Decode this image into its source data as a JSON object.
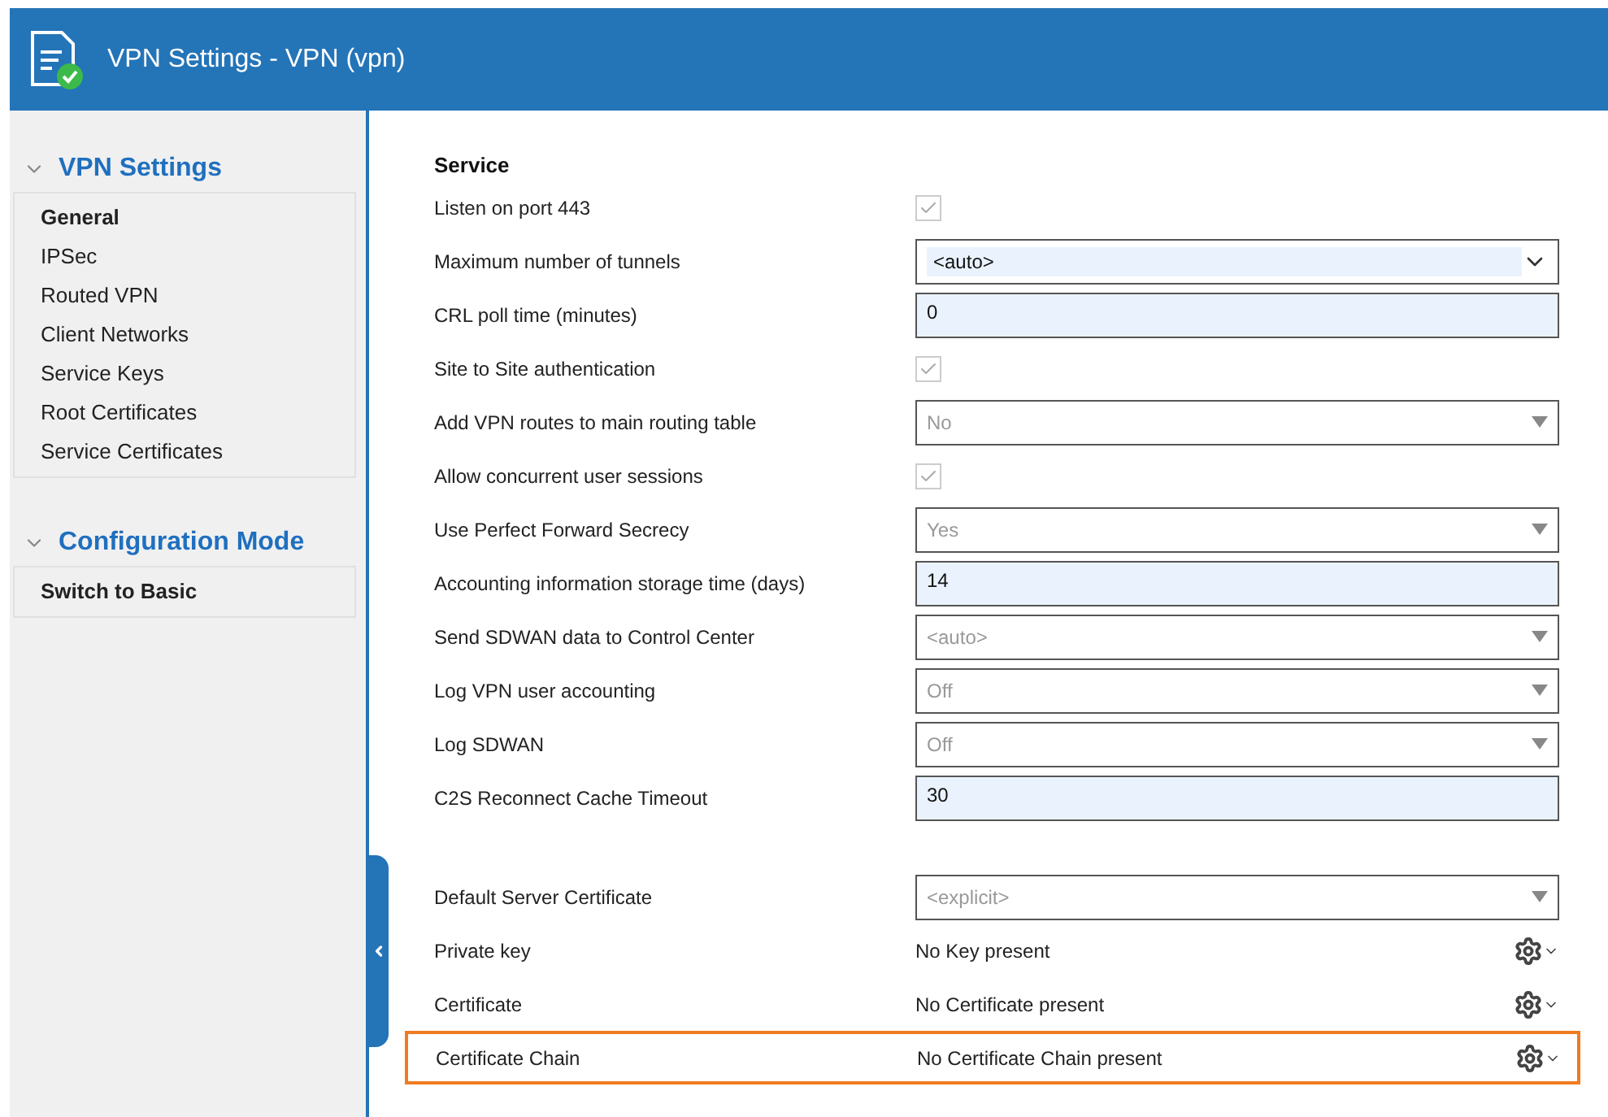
{
  "window": {
    "title": "VPN Settings - VPN (vpn)"
  },
  "sidebar": {
    "sections": [
      {
        "title": "VPN Settings",
        "expanded": true,
        "items": [
          {
            "label": "General",
            "selected": true,
            "kind": "page"
          },
          {
            "label": "IPSec",
            "selected": false,
            "kind": "page"
          },
          {
            "label": "Routed VPN",
            "selected": false,
            "kind": "page"
          },
          {
            "label": "Client Networks",
            "selected": false,
            "kind": "page"
          },
          {
            "label": "Service Keys",
            "selected": false,
            "kind": "page"
          },
          {
            "label": "Root Certificates",
            "selected": false,
            "kind": "page"
          },
          {
            "label": "Service Certificates",
            "selected": false,
            "kind": "page"
          }
        ]
      },
      {
        "title": "Configuration Mode",
        "expanded": true,
        "items": [
          {
            "label": "Switch to Basic",
            "selected": false,
            "kind": "action"
          }
        ]
      }
    ]
  },
  "service": {
    "title": "Service",
    "groups": [
      [
        {
          "label": "Listen on port 443",
          "kind": "checkbox",
          "checked": true,
          "disabled": true
        },
        {
          "label": "Maximum number of tunnels",
          "kind": "combo",
          "value": "<auto>"
        },
        {
          "label": "CRL poll time (minutes)",
          "kind": "input",
          "value": "0"
        },
        {
          "label": "Site to Site authentication",
          "kind": "checkbox",
          "checked": true,
          "disabled": true
        },
        {
          "label": "Add VPN routes to main routing table",
          "kind": "select",
          "value": "No",
          "disabled": true
        },
        {
          "label": "Allow concurrent user sessions",
          "kind": "checkbox",
          "checked": true,
          "disabled": true
        },
        {
          "label": "Use Perfect Forward Secrecy",
          "kind": "select",
          "value": "Yes",
          "disabled": true
        },
        {
          "label": "Accounting information storage time (days)",
          "kind": "input",
          "value": "14"
        },
        {
          "label": "Send SDWAN data to Control Center",
          "kind": "select",
          "value": "<auto>",
          "disabled": true
        },
        {
          "label": "Log VPN user accounting",
          "kind": "select",
          "value": "Off",
          "disabled": true
        },
        {
          "label": "Log SDWAN",
          "kind": "select",
          "value": "Off",
          "disabled": true
        },
        {
          "label": "C2S Reconnect Cache Timeout",
          "kind": "input",
          "value": "30"
        }
      ],
      [
        {
          "label": "Default Server Certificate",
          "kind": "select",
          "value": "<explicit>",
          "disabled": true
        },
        {
          "label": "Private key",
          "kind": "status",
          "value": "No Key present",
          "highlighted": false
        },
        {
          "label": "Certificate",
          "kind": "status",
          "value": "No Certificate present",
          "highlighted": false
        },
        {
          "label": "Certificate Chain",
          "kind": "status",
          "value": "No Certificate Chain present",
          "highlighted": true
        }
      ]
    ]
  }
}
